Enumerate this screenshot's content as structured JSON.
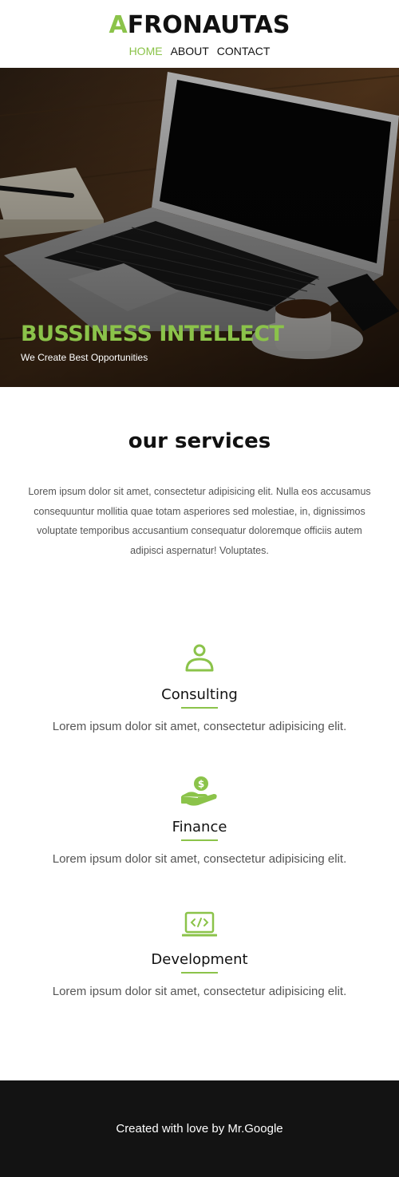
{
  "brand": {
    "first_letter": "A",
    "rest": "FRONAUTAS",
    "accent_color": "#8bc34a"
  },
  "nav": {
    "items": [
      {
        "label": "HOME",
        "active": true
      },
      {
        "label": "ABOUT"
      },
      {
        "label": "CONTACT"
      }
    ]
  },
  "hero": {
    "title": "BUSSINESS INTELLECT",
    "subtitle": "We Create Best Opportunities",
    "image_icon": "laptop-desk-photo"
  },
  "services": {
    "title": "our services",
    "intro": "Lorem ipsum dolor sit amet, consectetur adipisicing elit. Nulla eos accusamus consequuntur mollitia quae totam asperiores sed molestiae, in, dignissimos voluptate temporibus accusantium consequatur doloremque officiis autem adipisci aspernatur! Voluptates.",
    "items": [
      {
        "name": "Consulting",
        "description": "Lorem ipsum dolor sit amet, consectetur adipisicing elit.",
        "icon": "user-icon"
      },
      {
        "name": "Finance",
        "description": "Lorem ipsum dolor sit amet, consectetur adipisicing elit.",
        "icon": "money-hand-icon"
      },
      {
        "name": "Development",
        "description": "Lorem ipsum dolor sit amet, consectetur adipisicing elit.",
        "icon": "laptop-code-icon"
      }
    ]
  },
  "footer": {
    "text": "Created with love by Mr.Google"
  }
}
